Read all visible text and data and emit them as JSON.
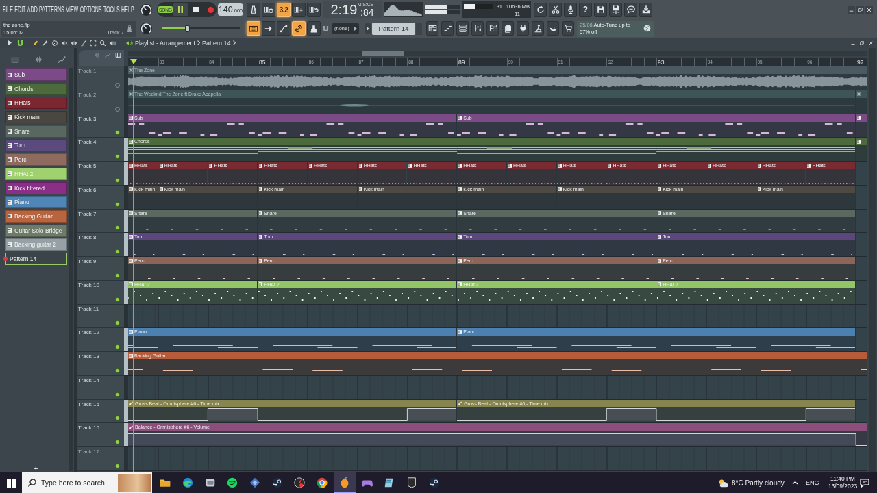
{
  "toolbar": {
    "menu": [
      "FILE",
      "EDIT",
      "ADD",
      "PATTERNS",
      "VIEW",
      "OPTIONS",
      "TOOLS",
      "HELP"
    ],
    "hint": {
      "file": "the zone.flp",
      "time": "15:05:02",
      "target": "Track 7"
    },
    "mode": {
      "label": "SONG",
      "on": true
    },
    "playing": true,
    "tempo": {
      "whole": "140",
      "fraction": ".000"
    },
    "record_options": [
      {
        "kind": "metronome",
        "on": false
      },
      {
        "kind": "wait",
        "on": false
      },
      {
        "kind": "countdown",
        "label": "3.2",
        "on": true
      },
      {
        "kind": "step",
        "on": false
      },
      {
        "kind": "loop",
        "on": false
      }
    ],
    "clock": {
      "format": "M:S:CS",
      "main": "2:19",
      "fraction": ":84"
    },
    "output_meter": [
      {
        "level": 0.62
      },
      {
        "level": 0.62
      }
    ],
    "performance": {
      "cpu_meter": {
        "level": 0.4
      },
      "cpu": "31",
      "memory": "10636 MB",
      "polyphony": "11"
    },
    "shortcuts": [
      {
        "kind": "undo"
      },
      {
        "kind": "cut"
      },
      {
        "kind": "mic"
      },
      {
        "kind": "help",
        "label": "?"
      },
      {
        "kind": "save"
      },
      {
        "kind": "save-split"
      },
      {
        "kind": "chat"
      },
      {
        "kind": "download"
      }
    ],
    "master_volume": {
      "level": 0.32
    },
    "edit_options": [
      {
        "kind": "typing",
        "on": true
      },
      {
        "kind": "arrow",
        "on": false
      },
      {
        "kind": "curve",
        "on": false
      },
      {
        "kind": "link",
        "on": true
      },
      {
        "kind": "stamp",
        "on": false
      }
    ],
    "snap": "(none)",
    "pattern": {
      "name": "Pattern 14",
      "add": "+"
    },
    "windows": [
      {
        "kind": "playlist"
      },
      {
        "kind": "piano-roll"
      },
      {
        "kind": "channel-rack"
      },
      {
        "kind": "mixer"
      },
      {
        "kind": "browser"
      },
      {
        "kind": "project"
      },
      {
        "kind": "plugin-database"
      },
      {
        "kind": "plugin-picker"
      },
      {
        "kind": "touch"
      },
      {
        "kind": "store"
      }
    ],
    "news": {
      "date": "25/08",
      "text": "Auto-Tune up to 57% off"
    }
  },
  "playlist_bar": {
    "tools": [
      {
        "kind": "draw",
        "selected": true
      },
      {
        "kind": "paint",
        "selected": false
      },
      {
        "kind": "delete",
        "selected": false
      },
      {
        "kind": "mute",
        "selected": false
      },
      {
        "kind": "slip",
        "selected": false
      },
      {
        "kind": "slice",
        "selected": false
      },
      {
        "kind": "select",
        "selected": false
      },
      {
        "kind": "zoom",
        "selected": false
      },
      {
        "kind": "playback",
        "selected": false
      }
    ],
    "title": "Playlist - Arrangement",
    "pattern": "Pattern 14"
  },
  "picker": {
    "tabs": [
      {
        "kind": "patterns",
        "selected": true
      },
      {
        "kind": "audio",
        "selected": false
      },
      {
        "kind": "automation",
        "selected": false
      }
    ],
    "items": [
      {
        "name": "Sub",
        "color": "#7c4a86",
        "selected": false
      },
      {
        "name": "Chords",
        "color": "#4c6a3c",
        "selected": false
      },
      {
        "name": "HHats",
        "color": "#7c2630",
        "selected": false
      },
      {
        "name": "Kick main",
        "color": "#4a4740",
        "selected": false
      },
      {
        "name": "Snare",
        "color": "#58675f",
        "selected": false
      },
      {
        "name": "Tom",
        "color": "#5b4a7e",
        "selected": false
      },
      {
        "name": "Perc",
        "color": "#8f6a5e",
        "selected": false
      },
      {
        "name": "HHAt 2",
        "color": "#9fd26f",
        "selected": false
      },
      {
        "name": "Kick filtered",
        "color": "#8a2e87",
        "selected": false
      },
      {
        "name": "Piano",
        "color": "#4f86b5",
        "selected": false
      },
      {
        "name": "Backing Guitar",
        "color": "#b8643f",
        "selected": false
      },
      {
        "name": "Guitar Solo Bridge",
        "color": "#6f7b69",
        "selected": false
      },
      {
        "name": "Backing guitar 2",
        "color": "#95a1a4",
        "selected": false
      },
      {
        "name": "Pattern 14",
        "color": "#3a4449",
        "selected": true
      }
    ],
    "add": "+"
  },
  "playlist": {
    "filters": [
      {
        "kind": "audio",
        "on": false
      },
      {
        "kind": "automation",
        "on": false
      },
      {
        "kind": "patterns",
        "on": true
      }
    ],
    "ruler": [
      "83",
      "84",
      "85",
      "86",
      "87",
      "88",
      "89",
      "90",
      "91",
      "92",
      "93",
      "94",
      "95",
      "96",
      "97"
    ],
    "tracks": [
      {
        "name": "Track 1",
        "kind": "audio",
        "enabled": false,
        "faded": true,
        "selected": false,
        "color": "#4b5a60",
        "clips": [
          {
            "name": "The Zone"
          }
        ]
      },
      {
        "name": "Track 2",
        "kind": "audio",
        "enabled": false,
        "faded": true,
        "selected": false,
        "color": "#3d5557",
        "clips": [
          {
            "name": "The Weeknd The Zone ft Drake Acapella"
          }
        ],
        "clip_at_edge": true
      },
      {
        "name": "Track 3",
        "kind": "pattern",
        "enabled": true,
        "faded": false,
        "selected": false,
        "color": "#7a4b85",
        "clips": [
          {
            "name": "Sub"
          },
          {
            "name": "Sub"
          }
        ],
        "clip_at_edge": true
      },
      {
        "name": "Track 4",
        "kind": "pattern",
        "enabled": true,
        "faded": false,
        "selected": true,
        "color": "#4d6a3d",
        "clips": [
          {
            "name": "Chords"
          }
        ],
        "clip_at_edge": true
      },
      {
        "name": "Track 5",
        "kind": "pattern",
        "enabled": true,
        "faded": false,
        "selected": true,
        "color": "#7a2b31",
        "clips": [
          {
            "name": "HHats"
          },
          {
            "name": "HHats"
          },
          {
            "name": "HHats"
          },
          {
            "name": "HHats"
          },
          {
            "name": "HHats"
          },
          {
            "name": "HHats"
          },
          {
            "name": "HHats"
          },
          {
            "name": "HHats"
          },
          {
            "name": "HHats"
          },
          {
            "name": "HHats"
          },
          {
            "name": "HHats"
          },
          {
            "name": "HHats"
          },
          {
            "name": "HHats"
          },
          {
            "name": "HHats"
          },
          {
            "name": "HHats"
          }
        ]
      },
      {
        "name": "Track 6",
        "kind": "pattern",
        "enabled": true,
        "faded": false,
        "selected": false,
        "color": "#4e4a43",
        "clips": [
          {
            "name": "Kick main"
          },
          {
            "name": "Kick main"
          },
          {
            "name": "Kick main"
          },
          {
            "name": "Kick main"
          },
          {
            "name": "Kick main"
          },
          {
            "name": "Kick main"
          },
          {
            "name": "Kick main"
          },
          {
            "name": "Kick main"
          }
        ]
      },
      {
        "name": "Track 7",
        "kind": "pattern",
        "enabled": true,
        "faded": false,
        "selected": true,
        "color": "#5a6861",
        "clips": [
          {
            "name": "Snare"
          },
          {
            "name": "Snare"
          },
          {
            "name": "Snare"
          },
          {
            "name": "Snare"
          }
        ]
      },
      {
        "name": "Track 8",
        "kind": "pattern",
        "enabled": true,
        "faded": false,
        "selected": true,
        "color": "#5b477b",
        "clips": [
          {
            "name": "Tom"
          },
          {
            "name": "Tom"
          },
          {
            "name": "Tom"
          },
          {
            "name": "Tom"
          }
        ]
      },
      {
        "name": "Track 9",
        "kind": "pattern",
        "enabled": true,
        "faded": false,
        "selected": false,
        "color": "#8d6558",
        "clips": [
          {
            "name": "Perc"
          },
          {
            "name": "Perc"
          },
          {
            "name": "Perc"
          },
          {
            "name": "Perc"
          }
        ]
      },
      {
        "name": "Track 10",
        "kind": "pattern",
        "enabled": true,
        "faded": false,
        "selected": true,
        "color": "#93c566",
        "clips": [
          {
            "name": "HHAt 2"
          },
          {
            "name": "HHAt 2"
          },
          {
            "name": "HHAt 2"
          },
          {
            "name": "HHAt 2"
          }
        ]
      },
      {
        "name": "Track 11",
        "enabled": true,
        "faded": false,
        "selected": false
      },
      {
        "name": "Track 12",
        "kind": "pattern",
        "enabled": true,
        "faded": false,
        "selected": true,
        "color": "#4b80b0",
        "clips": [
          {
            "name": "Piano"
          },
          {
            "name": "Piano"
          }
        ]
      },
      {
        "name": "Track 13",
        "kind": "pattern",
        "enabled": true,
        "faded": false,
        "selected": true,
        "color": "#b65c3b",
        "clips": [
          {
            "name": "Backing Guitar"
          }
        ]
      },
      {
        "name": "Track 14",
        "enabled": true,
        "faded": false,
        "selected": false
      },
      {
        "name": "Track 15",
        "kind": "automation",
        "enabled": true,
        "faded": false,
        "selected": true,
        "color": "#86854f",
        "clips": [
          {
            "name": "Gross Beat - Omnisphere #6 - Time mix"
          },
          {
            "name": "Gross Beat - Omnisphere #6 - Time mix"
          }
        ]
      },
      {
        "name": "Track 16",
        "kind": "automation",
        "enabled": true,
        "faded": false,
        "selected": true,
        "color": "#8c4f7b",
        "clips": [
          {
            "name": "Balance - Omnisphere #6 - Volume"
          }
        ]
      },
      {
        "name": "Track 17",
        "enabled": true,
        "faded": true,
        "selected": false
      }
    ]
  },
  "taskbar": {
    "search": {
      "placeholder": "Type here to search"
    },
    "apps": [
      {
        "kind": "folder",
        "active": false
      },
      {
        "kind": "swirl",
        "active": false
      },
      {
        "kind": "window",
        "active": false
      },
      {
        "kind": "arcs",
        "active": false
      },
      {
        "kind": "diamond",
        "active": false
      },
      {
        "kind": "piston",
        "active": false
      },
      {
        "kind": "gauge",
        "active": false
      },
      {
        "kind": "ring",
        "active": false
      },
      {
        "kind": "fruit",
        "active": true
      },
      {
        "kind": "gamepad",
        "active": false
      },
      {
        "kind": "notebook",
        "active": false
      },
      {
        "kind": "shield",
        "active": false
      },
      {
        "kind": "piston",
        "active": false
      }
    ],
    "weather": "8°C Partly cloudy",
    "language": "ENG",
    "time": "11:40 PM",
    "date": "13/09/2023"
  }
}
